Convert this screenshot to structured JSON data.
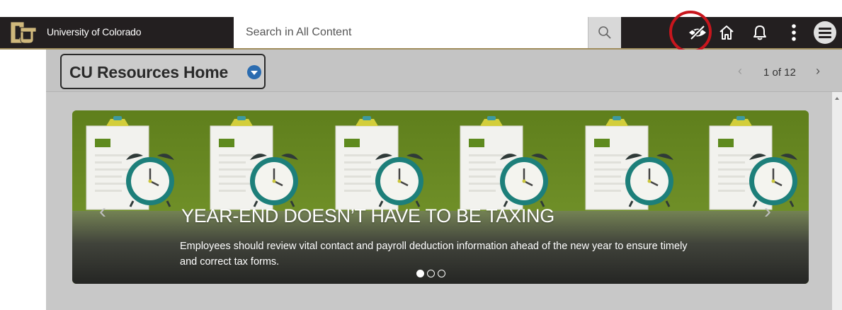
{
  "header": {
    "brand_name": "University of Colorado",
    "search_placeholder": "Search in All Content",
    "icons": [
      "cu-logo",
      "search-icon",
      "hide-icon",
      "home-icon",
      "bell-icon",
      "kebab-menu-icon",
      "hamburger-menu-icon"
    ]
  },
  "colors": {
    "header_dark": "#231f20",
    "gold_accent": "#a08d5d",
    "highlight_red": "#c8161d",
    "banner_green": "#6b8a25",
    "caret_blue": "#2b6cb0"
  },
  "page": {
    "selector_label": "CU Resources Home",
    "pager_prev": "‹",
    "pager_text": "1 of 12",
    "pager_next": "›"
  },
  "banner": {
    "title": "YEAR-END DOESN’T HAVE TO BE TAXING",
    "description": "Employees should review vital contact and payroll deduction information ahead of the new year to ensure timely and correct tax forms.",
    "arrow_left": "‹",
    "arrow_right": "›",
    "slide_count": 3,
    "active_slide": 1
  }
}
